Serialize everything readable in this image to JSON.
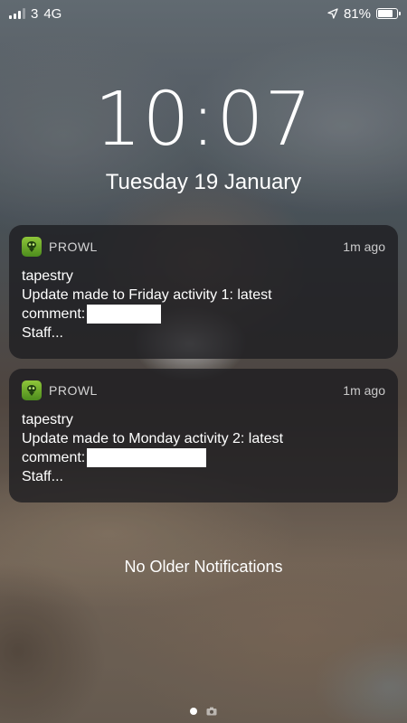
{
  "status_bar": {
    "carrier": "3",
    "network": "4G",
    "battery_percent": "81%",
    "battery_level": 0.81,
    "signal_bars": 3,
    "signal_bars_total": 4
  },
  "lock_screen": {
    "time": "10:07",
    "date": "Tuesday 19 January"
  },
  "notifications": [
    {
      "app": "PROWL",
      "time": "1m ago",
      "title": "tapestry",
      "line1": "Update made to Friday activity 1: latest",
      "line2": "comment:",
      "line3": "Staff..."
    },
    {
      "app": "PROWL",
      "time": "1m ago",
      "title": "tapestry",
      "line1": "Update made to Monday activity 2: latest",
      "line2": "comment:",
      "line3": "Staff..."
    }
  ],
  "footer": {
    "no_older": "No Older Notifications"
  },
  "colors": {
    "app_icon": "#6aa82c",
    "notification_bg": "#1c1c20"
  },
  "icons": [
    "signal-icon",
    "location-arrow-icon",
    "battery-icon",
    "prowl-app-icon",
    "camera-icon"
  ]
}
